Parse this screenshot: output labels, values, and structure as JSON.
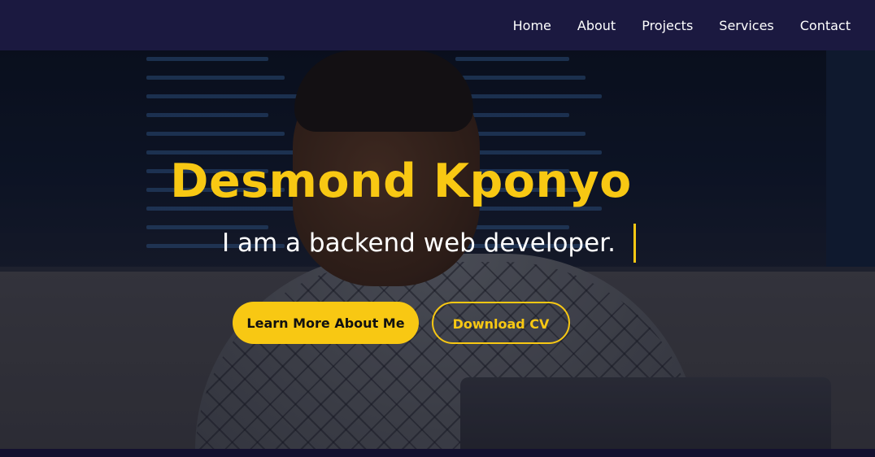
{
  "nav": {
    "links": [
      "Home",
      "About",
      "Projects",
      "Services",
      "Contact"
    ]
  },
  "hero": {
    "name": "Desmond Kponyo",
    "tagline": "I am a backend web developer.",
    "primary_button": "Learn More About Me",
    "secondary_button": "Download CV"
  },
  "colors": {
    "accent": "#f8c813",
    "navbar": "#1b1940",
    "text": "#ffffff"
  }
}
